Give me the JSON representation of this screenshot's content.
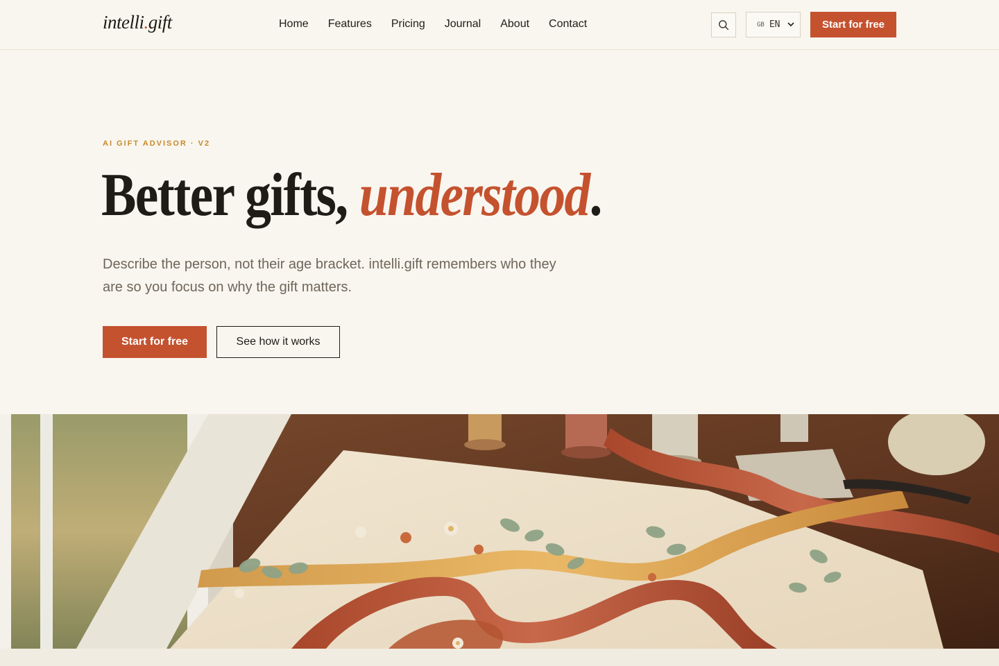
{
  "brand": {
    "name_part1": "intelli",
    "name_dot": ".",
    "name_part2": "gift"
  },
  "nav": {
    "items": [
      {
        "label": "Home"
      },
      {
        "label": "Features"
      },
      {
        "label": "Pricing"
      },
      {
        "label": "Journal"
      },
      {
        "label": "About"
      },
      {
        "label": "Contact"
      }
    ]
  },
  "header": {
    "search_icon": "search-icon",
    "language": {
      "flag": "GB",
      "code": "EN"
    },
    "cta_label": "Start for free"
  },
  "hero": {
    "eyebrow": "AI GIFT ADVISOR · V2",
    "headline_main": "Better gifts, ",
    "headline_accent": "understood",
    "headline_end": ".",
    "subcopy": "Describe the person, not their age bracket. intelli.gift remembers who they are so you focus on why the gift matters.",
    "primary_button": "Start for free",
    "secondary_button": "See how it works"
  },
  "colors": {
    "background": "#f9f6ef",
    "accent": "#c4522f",
    "eyebrow": "#c78a2c",
    "text": "#1f1b16",
    "muted_text": "#6e665a"
  }
}
